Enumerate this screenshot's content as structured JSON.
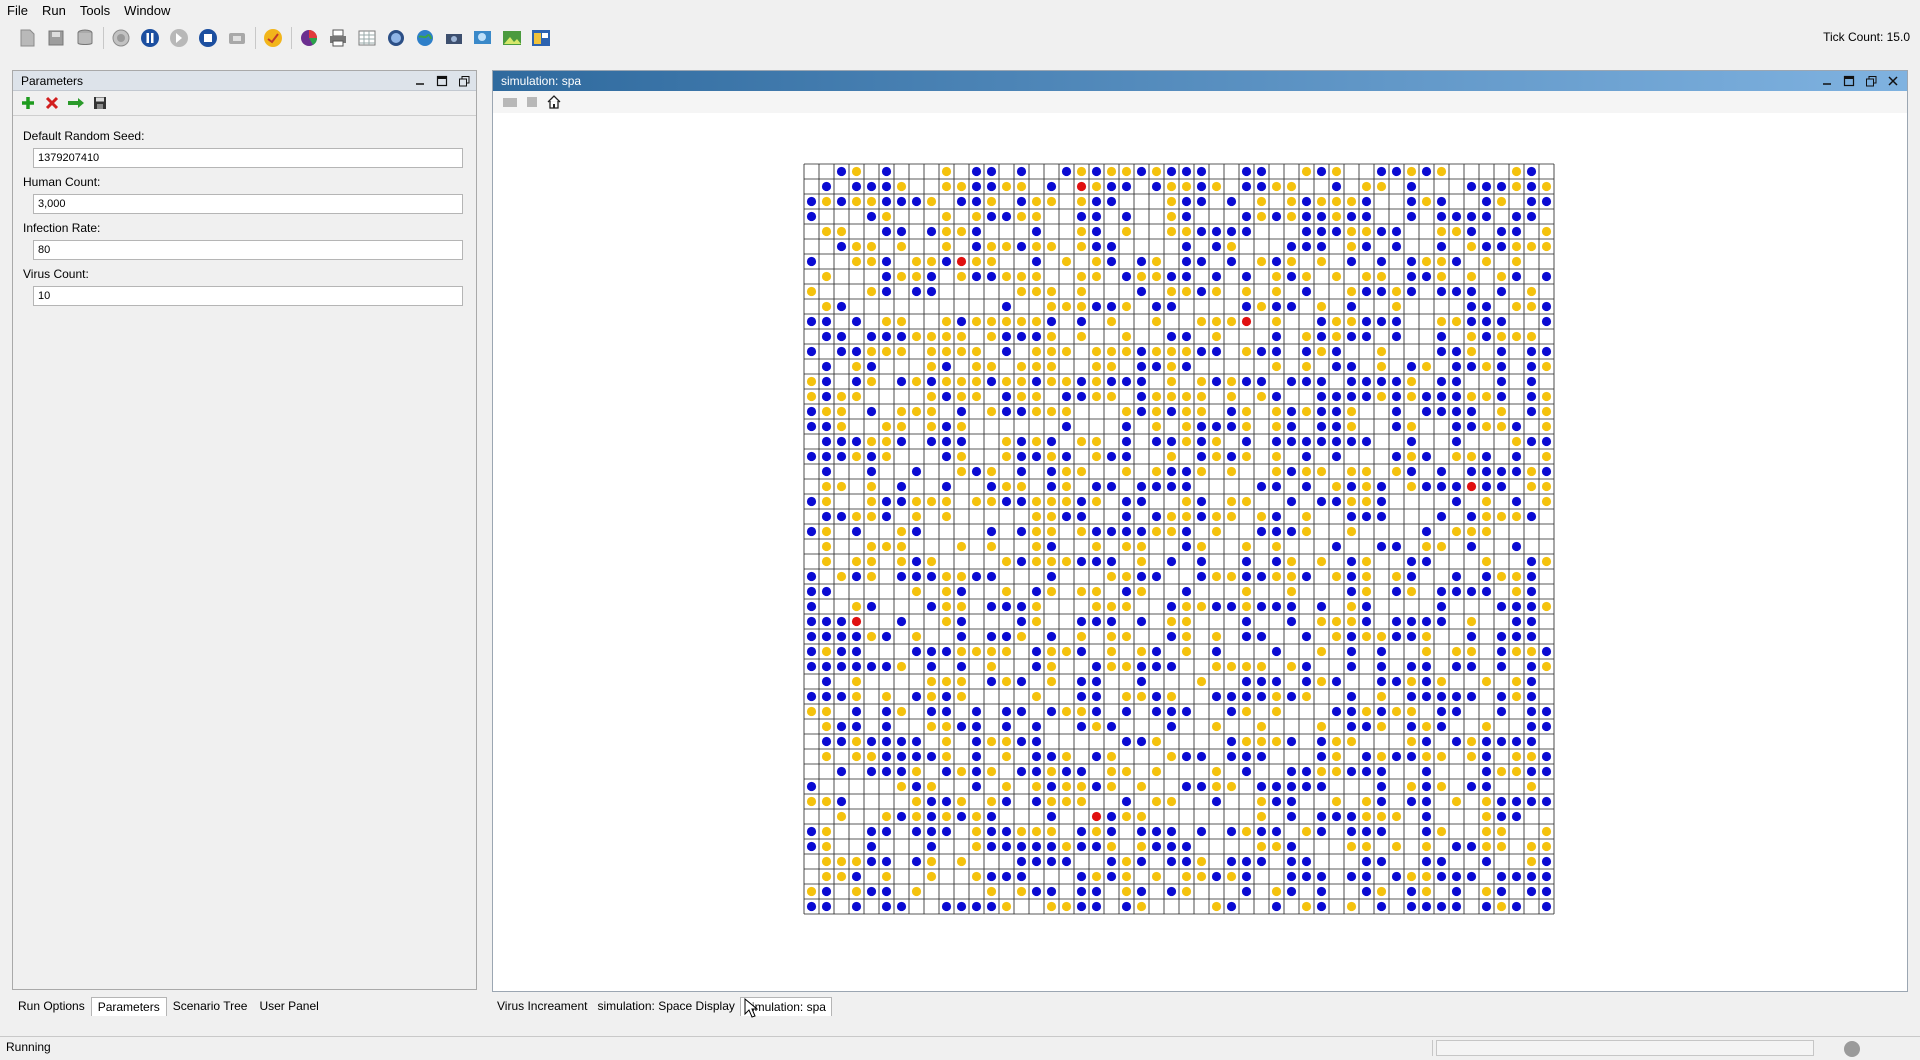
{
  "menubar": {
    "items": [
      "File",
      "Run",
      "Tools",
      "Window"
    ]
  },
  "toolbar": {
    "icons": [
      "new-file-icon",
      "save-icon",
      "database-icon",
      "init-icon",
      "pause-icon",
      "step-icon",
      "stop-icon",
      "reset-icon",
      "batch-icon",
      "chart-icon",
      "printer-icon",
      "table-icon",
      "layer-icon",
      "globe-icon",
      "camera-icon",
      "zoom-icon",
      "image-icon",
      "window-icon"
    ]
  },
  "tick_count": "Tick Count: 15.0",
  "parameters_panel": {
    "title": "Parameters",
    "fields": [
      {
        "label": "Default Random Seed:",
        "value": "1379207410"
      },
      {
        "label": "Human Count:",
        "value": "3,000"
      },
      {
        "label": "Infection Rate:",
        "value": "80"
      },
      {
        "label": "Virus Count:",
        "value": "10"
      }
    ]
  },
  "left_tabs": [
    "Run Options",
    "Parameters",
    "Scenario Tree",
    "User Panel"
  ],
  "left_tabs_active": 1,
  "display": {
    "title": "simulation: spa",
    "grid": {
      "cols": 50,
      "rows": 50,
      "colors": {
        "human": "#0a0ad2",
        "virus": "#f4c20d",
        "infected": "#e01010",
        "line": "#222222"
      },
      "infected_cells": [
        [
          18,
          1
        ],
        [
          10,
          6
        ],
        [
          29,
          10
        ],
        [
          44,
          21
        ],
        [
          3,
          30
        ],
        [
          19,
          43
        ]
      ]
    }
  },
  "bottom_tabs": [
    "Virus Increament",
    "simulation: Space Display",
    "simulation: spa"
  ],
  "bottom_tabs_active": 2,
  "status": {
    "text": "Running"
  }
}
